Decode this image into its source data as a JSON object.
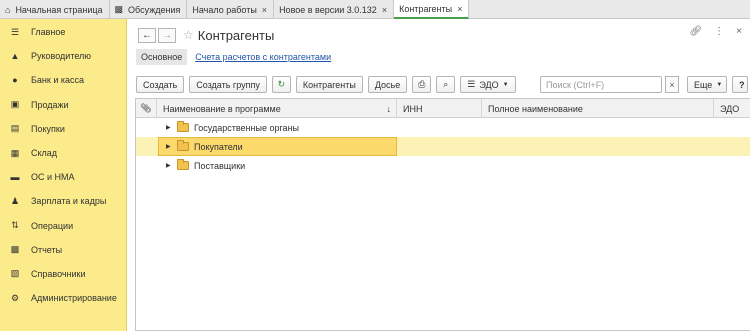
{
  "tabs": [
    {
      "label": "Начальная страница",
      "icon": "home-icon",
      "closable": false,
      "active": false
    },
    {
      "label": "Обсуждения",
      "icon": "chat-icon",
      "closable": false,
      "active": false
    },
    {
      "label": "Начало работы",
      "closable": true,
      "active": false
    },
    {
      "label": "Новое в версии 3.0.132",
      "closable": true,
      "active": false
    },
    {
      "label": "Контрагенты",
      "closable": true,
      "active": true
    }
  ],
  "sidebar": {
    "items": [
      {
        "label": "Главное",
        "icon": "menu-icon"
      },
      {
        "label": "Руководителю",
        "icon": "chart-icon"
      },
      {
        "label": "Банк и касса",
        "icon": "coin-icon"
      },
      {
        "label": "Продажи",
        "icon": "bag-icon"
      },
      {
        "label": "Покупки",
        "icon": "cart-icon"
      },
      {
        "label": "Склад",
        "icon": "warehouse-icon"
      },
      {
        "label": "ОС и НМА",
        "icon": "truck-icon"
      },
      {
        "label": "Зарплата и кадры",
        "icon": "people-icon"
      },
      {
        "label": "Операции",
        "icon": "operations-icon"
      },
      {
        "label": "Отчеты",
        "icon": "reports-icon"
      },
      {
        "label": "Справочники",
        "icon": "books-icon"
      },
      {
        "label": "Администрирование",
        "icon": "gear-icon"
      }
    ]
  },
  "header": {
    "title": "Контрагенты",
    "back_label": "←",
    "forward_label": "→"
  },
  "subtabs": {
    "active": "Основное",
    "link": "Счета расчетов с контрагентами"
  },
  "toolbar": {
    "create": "Создать",
    "create_group": "Создать группу",
    "counterparties": "Контрагенты",
    "dossier": "Досье",
    "edo": "ЭДО",
    "search_placeholder": "Поиск (Ctrl+F)",
    "search_clear": "×",
    "more": "Еще",
    "help": "?"
  },
  "table": {
    "columns": [
      "Наименование в программе",
      "ИНН",
      "Полное наименование",
      "ЭДО"
    ],
    "rows": [
      {
        "label": "Государственные органы",
        "selected": false
      },
      {
        "label": "Покупатели",
        "selected": true
      },
      {
        "label": "Поставщики",
        "selected": false
      }
    ]
  },
  "colors": {
    "sidebar_bg": "#fbeb8a",
    "active_tab_accent": "#4aa04a",
    "selection": "#fbd96b",
    "link": "#2357a8"
  }
}
